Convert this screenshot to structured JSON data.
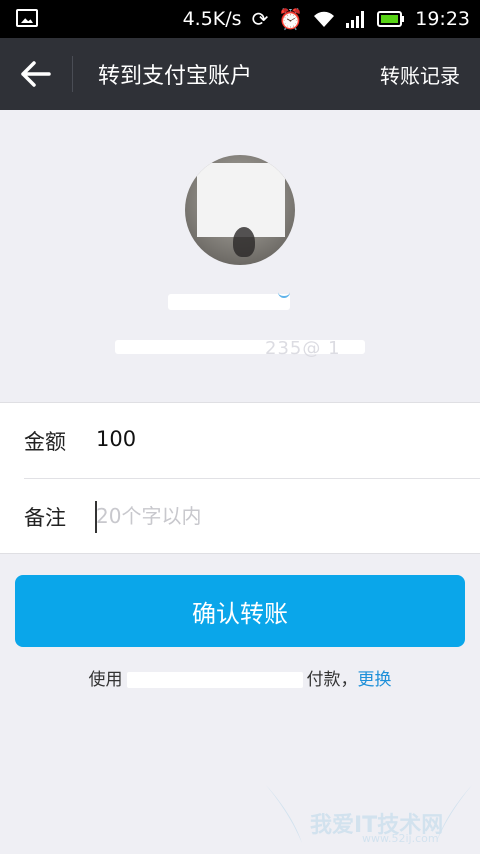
{
  "status": {
    "speed": "4.5K/s",
    "time": "19:23"
  },
  "nav": {
    "title": "转到支付宝账户",
    "action": "转账记录"
  },
  "profile": {
    "account_fragment": "235@ 1"
  },
  "form": {
    "amount_label": "金额",
    "amount_value": "100",
    "memo_label": "备注",
    "memo_placeholder": "20个字以内"
  },
  "confirm_label": "确认转账",
  "payment": {
    "prefix": "使用",
    "suffix": "付款，",
    "change_label": "更换"
  },
  "watermark": {
    "text": "我爱IT技术网",
    "sub": "www.52ij.com"
  }
}
